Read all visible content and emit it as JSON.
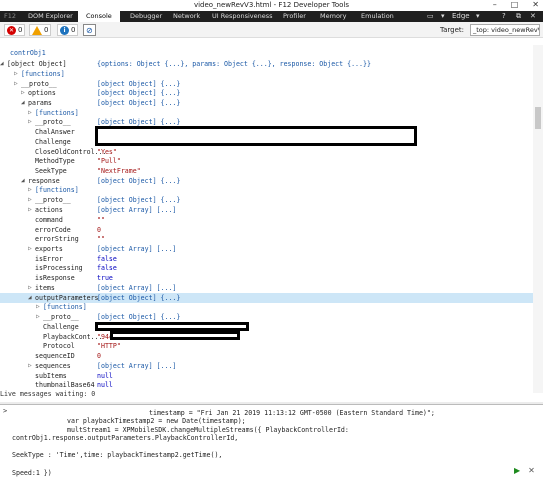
{
  "window": {
    "title": "video_newRevV3.html - F12 Developer Tools",
    "controls": [
      "–",
      "□",
      "✕"
    ]
  },
  "tabs": {
    "f12": "F12",
    "items": [
      "DOM Explorer",
      "Console",
      "Debugger",
      "Network",
      "UI Responsiveness",
      "Profiler",
      "Memory",
      "Emulation"
    ],
    "active": "Console",
    "browser": "Edge"
  },
  "toolbar": {
    "errors": "0",
    "warnings": "0",
    "info": "0",
    "target_label": "Target:",
    "target_value": "_top: video_newRevV3.h"
  },
  "output": {
    "rows": [
      {
        "key": "contrObj1",
        "val": "",
        "kind": "root"
      },
      {
        "key": "[object Object]",
        "val": "{options: Object {...}, params: Object {...}, response: Object {...}}",
        "kind": "obj",
        "arrow": "◢"
      },
      {
        "key": "[functions]",
        "val": "",
        "kind": "fn",
        "arrow": "▷"
      },
      {
        "key": "__proto__",
        "val": "[object Object] {...}",
        "kind": "obj",
        "arrow": "▷"
      },
      {
        "key": "options",
        "val": "[object Object] {...}",
        "kind": "obj",
        "arrow": "▷"
      },
      {
        "key": "params",
        "val": "[object Object] {...}",
        "kind": "obj",
        "arrow": "◢"
      },
      {
        "key": "[functions]",
        "val": "",
        "kind": "fn",
        "arrow": "▷"
      },
      {
        "key": "__proto__",
        "val": "[object Object] {...}",
        "kind": "obj",
        "arrow": "▷"
      },
      {
        "key": "ChalAnswer",
        "val": "",
        "kind": "str"
      },
      {
        "key": "Challenge",
        "val": "",
        "kind": "str"
      },
      {
        "key": "CloseOldControl...",
        "val": "\"Yes\"",
        "kind": "str"
      },
      {
        "key": "MethodType",
        "val": "\"Pull\"",
        "kind": "str"
      },
      {
        "key": "SeekType",
        "val": "\"NextFrame\"",
        "kind": "str"
      },
      {
        "key": "response",
        "val": "[object Object] {...}",
        "kind": "obj",
        "arrow": "◢"
      },
      {
        "key": "[functions]",
        "val": "",
        "kind": "fn",
        "arrow": "▷"
      },
      {
        "key": "__proto__",
        "val": "[object Object] {...}",
        "kind": "obj",
        "arrow": "▷"
      },
      {
        "key": "actions",
        "val": "[object Array] [...]",
        "kind": "obj",
        "arrow": "▷"
      },
      {
        "key": "command",
        "val": "\"\"",
        "kind": "str"
      },
      {
        "key": "errorCode",
        "val": "0",
        "kind": "num"
      },
      {
        "key": "errorString",
        "val": "\"\"",
        "kind": "str"
      },
      {
        "key": "exports",
        "val": "[object Array] [...]",
        "kind": "obj",
        "arrow": "▷"
      },
      {
        "key": "isError",
        "val": "false",
        "kind": "bool"
      },
      {
        "key": "isProcessing",
        "val": "false",
        "kind": "bool"
      },
      {
        "key": "isResponse",
        "val": "true",
        "kind": "bool"
      },
      {
        "key": "items",
        "val": "[object Array] [...]",
        "kind": "obj",
        "arrow": "▷"
      },
      {
        "key": "outputParameters",
        "val": "[object Object] {...}",
        "kind": "obj",
        "arrow": "◢"
      },
      {
        "key": "[functions]",
        "val": "",
        "kind": "fn",
        "arrow": "▷"
      },
      {
        "key": "__proto__",
        "val": "[object Object] {...}",
        "kind": "obj",
        "arrow": "▷"
      },
      {
        "key": "Challenge",
        "val": "",
        "kind": "str"
      },
      {
        "key": "PlaybackCont...",
        "val": "\"94c",
        "kind": "str"
      },
      {
        "key": "Protocol",
        "val": "\"HTTP\"",
        "kind": "str"
      },
      {
        "key": "sequenceID",
        "val": "0",
        "kind": "num"
      },
      {
        "key": "sequences",
        "val": "[object Array] [...]",
        "kind": "obj",
        "arrow": "▷"
      },
      {
        "key": "subItems",
        "val": "null",
        "kind": "bool"
      },
      {
        "key": "thumbnailBase64",
        "val": "null",
        "kind": "bool"
      }
    ],
    "live_messages": "Live messages waiting: 0"
  },
  "input": {
    "prompt": ">",
    "lines": [
      "timestamp = \"Fri Jan 21 2019 11:13:12 GMT-0500 (Eastern Standard Time)\";",
      "var playbackTimestamp2 = new Date(timestamp);",
      "multStream1 = XPMobileSDK.changeMultipleStreams({ PlaybackControllerId:",
      "contrObj1.response.outputParameters.PlaybackControllerId,",
      "",
      "SeekType : 'Time',time: playbackTimestamp2.getTime(),",
      "",
      "Speed:1 })"
    ]
  },
  "colors": {
    "tabbar": "#1f1f1f",
    "object_value": "#1a58a6",
    "string_value": "#a31515",
    "highlight": "#cde6f7"
  }
}
